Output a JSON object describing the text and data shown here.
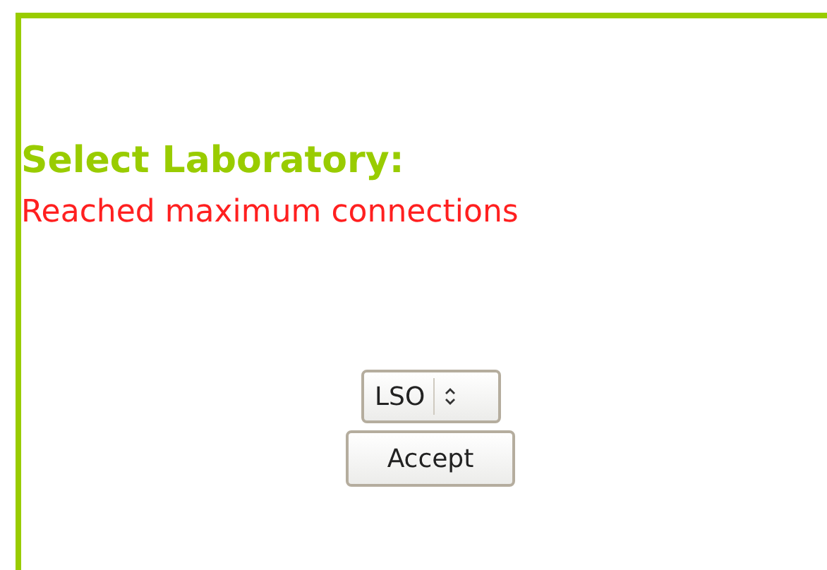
{
  "heading": "Select Laboratory:",
  "error": "Reached maximum connections",
  "laboratory_select": {
    "value": "LSO"
  },
  "buttons": [
    "Accept"
  ]
}
